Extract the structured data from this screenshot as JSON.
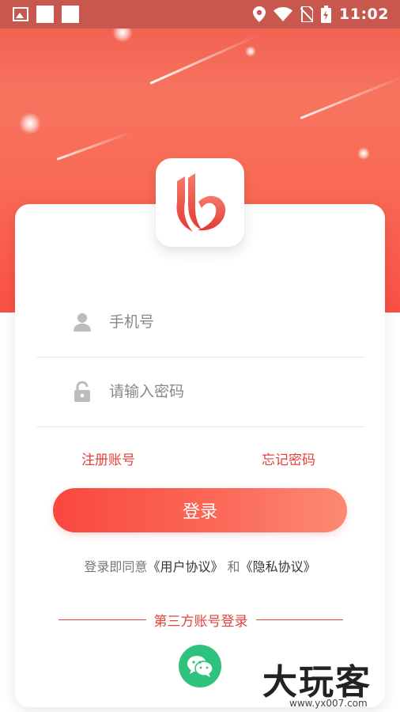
{
  "status_bar": {
    "time": "11:02"
  },
  "login_form": {
    "phone_placeholder": "手机号",
    "password_placeholder": "请输入密码",
    "register_link": "注册账号",
    "forgot_link": "忘记密码",
    "login_button": "登录",
    "agreement_prefix": "登录即同意",
    "user_agreement": "《用户协议》",
    "and_word": "和",
    "privacy_policy": "《隐私协议》",
    "third_party_label": "第三方账号登录"
  },
  "icons": [
    "person-icon",
    "lock-icon",
    "wechat-icon",
    "location-icon",
    "wifi-icon",
    "battery-icon"
  ],
  "colors": {
    "accent": "#e2423b",
    "button_start": "#f9473f",
    "button_end": "#fc8a73",
    "wechat": "#2ec27e"
  },
  "watermark": {
    "big": "大玩客",
    "small": "www.yx007.com"
  }
}
